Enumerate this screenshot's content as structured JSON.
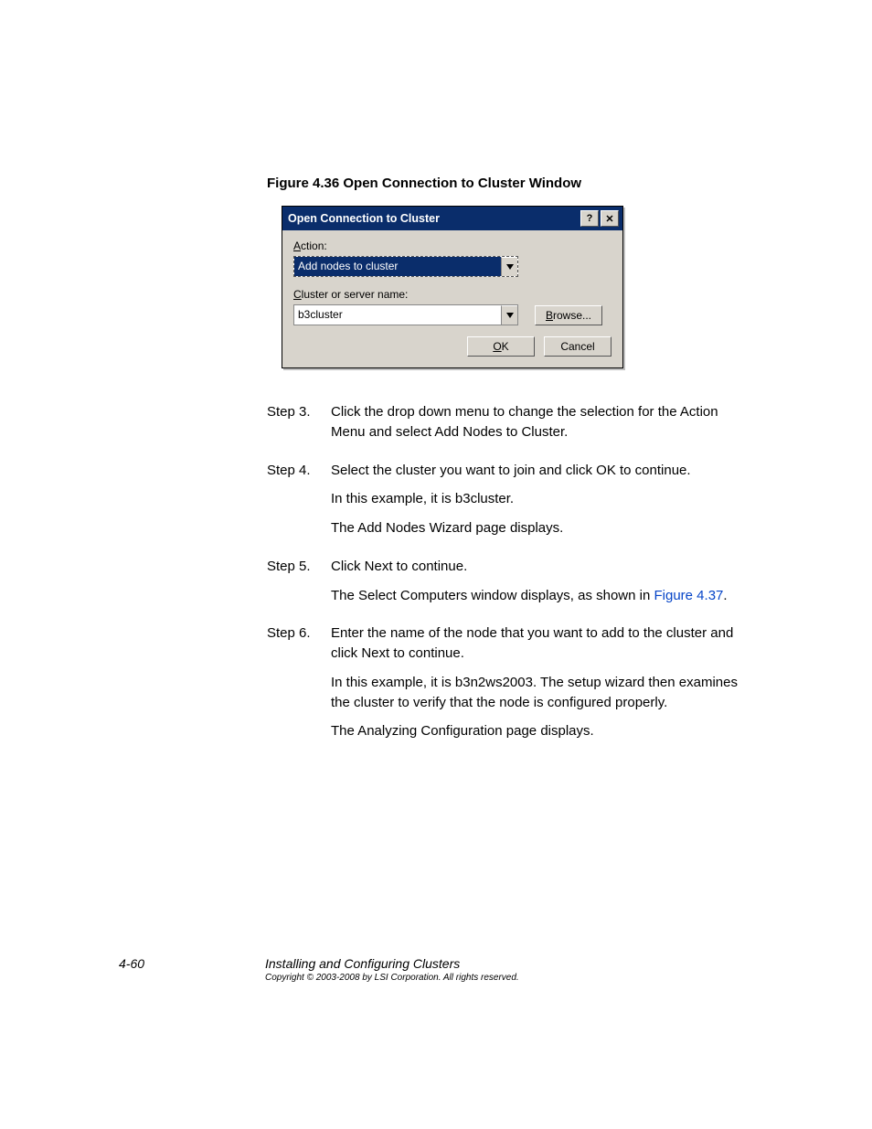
{
  "figure_caption": "Figure 4.36   Open Connection to Cluster Window",
  "dialog": {
    "title": "Open Connection to Cluster",
    "help_glyph": "?",
    "close_glyph": "✕",
    "action_label_pre": "A",
    "action_label_post": "ction:",
    "action_value": "Add nodes to cluster",
    "server_label_pre": "C",
    "server_label_post": "luster or server name:",
    "server_value": "b3cluster",
    "browse_pre": "B",
    "browse_post": "rowse...",
    "ok_pre": "O",
    "ok_post": "K",
    "cancel": "Cancel"
  },
  "steps": {
    "s3_label": "Step 3.",
    "s3_p1": "Click the drop down menu to change the selection for the Action Menu and select Add Nodes to Cluster.",
    "s4_label": "Step 4.",
    "s4_p1": "Select the cluster you want to join and click OK to continue.",
    "s4_p2": "In this example, it is b3cluster.",
    "s4_p3": "The Add Nodes Wizard page displays.",
    "s5_label": "Step 5.",
    "s5_p1": "Click Next to continue.",
    "s5_p2a": "The Select Computers window displays, as shown in ",
    "s5_link": "Figure 4.37",
    "s5_p2b": ".",
    "s6_label": "Step 6.",
    "s6_p1": "Enter the name of the node that you want to add to the cluster and click Next to continue.",
    "s6_p2": "In this example, it is b3n2ws2003. The setup wizard then examines the cluster to verify that the node is configured properly.",
    "s6_p3": "The Analyzing Configuration page displays."
  },
  "footer": {
    "page_num": "4-60",
    "title": "Installing and Configuring Clusters",
    "copyright": "Copyright © 2003-2008 by LSI Corporation. All rights reserved."
  }
}
